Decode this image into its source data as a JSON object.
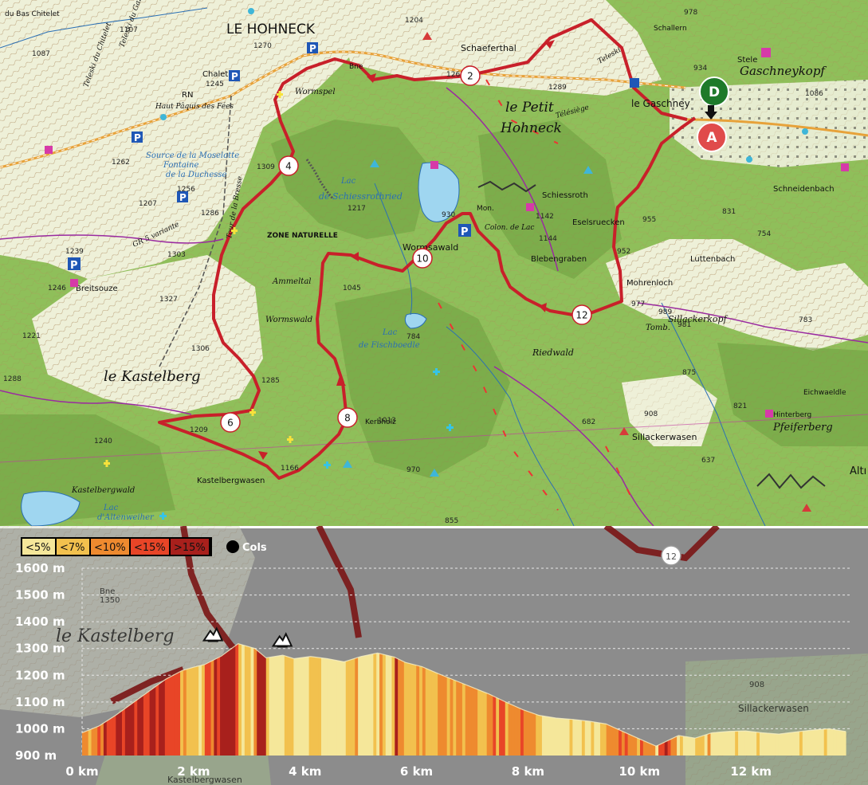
{
  "map": {
    "labels": [
      {
        "text": "LE HOHNECK",
        "cls": "ml",
        "size": 17
      },
      {
        "text": "Schaeferthal",
        "cls": "ml",
        "size": 11
      },
      {
        "text": "le Petit",
        "cls": "ml-it",
        "size": 17
      },
      {
        "text": "Hohneck",
        "cls": "ml-it",
        "size": 17
      },
      {
        "text": "le Gaschney",
        "cls": "ml",
        "size": 12
      },
      {
        "text": "Gaschneykopf",
        "cls": "ml-it",
        "size": 15
      },
      {
        "text": "Chalet",
        "cls": "ml",
        "size": 10
      },
      {
        "text": "Haut Pâquis des Fées",
        "cls": "ml-it",
        "size": 9
      },
      {
        "text": "Source de la Moselotte",
        "cls": "ml-blue",
        "size": 10
      },
      {
        "text": "Fontaine",
        "cls": "ml-blue",
        "size": 10
      },
      {
        "text": "de la Duchesse",
        "cls": "ml-blue",
        "size": 10
      },
      {
        "text": "Lac",
        "cls": "ml-blue",
        "size": 10
      },
      {
        "text": "de Schiessrothried",
        "cls": "ml-blue",
        "size": 11
      },
      {
        "text": "ZONE NATURELLE",
        "cls": "ml-bold",
        "size": 9
      },
      {
        "text": "Wormsawald",
        "cls": "ml",
        "size": 11
      },
      {
        "text": "Schiessroth",
        "cls": "ml",
        "size": 10
      },
      {
        "text": "Eselsruecken",
        "cls": "ml",
        "size": 10
      },
      {
        "text": "Blebengraben",
        "cls": "ml",
        "size": 10
      },
      {
        "text": "Mohrenloch",
        "cls": "ml",
        "size": 10
      },
      {
        "text": "Luttenbach",
        "cls": "ml",
        "size": 10
      },
      {
        "text": "Schneidenbach",
        "cls": "ml",
        "size": 10
      },
      {
        "text": "Sillackerkopf",
        "cls": "ml-it",
        "size": 11
      },
      {
        "text": "Riedwald",
        "cls": "ml-it",
        "size": 11
      },
      {
        "text": "Lac",
        "cls": "ml-blue",
        "size": 10
      },
      {
        "text": "de Fischboedle",
        "cls": "ml-blue",
        "size": 10
      },
      {
        "text": "Wormswald",
        "cls": "ml-it",
        "size": 10
      },
      {
        "text": "Ammeltal",
        "cls": "ml-it",
        "size": 10
      },
      {
        "text": "le Kastelberg",
        "cls": "ml-it",
        "size": 18
      },
      {
        "text": "Breitsouze",
        "cls": "ml",
        "size": 10
      },
      {
        "text": "Kastelbergwasen",
        "cls": "ml",
        "size": 10
      },
      {
        "text": "Kastelbergwald",
        "cls": "ml-it",
        "size": 10
      },
      {
        "text": "Lac",
        "cls": "ml-blue",
        "size": 10
      },
      {
        "text": "d'Altenweiher",
        "cls": "ml-blue",
        "size": 10
      },
      {
        "text": "Sillackerwasen",
        "cls": "ml",
        "size": 11
      },
      {
        "text": "Pfeiferberg",
        "cls": "ml-it",
        "size": 13
      },
      {
        "text": "Hinterberg",
        "cls": "ml",
        "size": 9
      },
      {
        "text": "Eichwaeldle",
        "cls": "ml",
        "size": 9
      },
      {
        "text": "Tomb.",
        "cls": "ml-it",
        "size": 10
      },
      {
        "text": "Stele",
        "cls": "ml",
        "size": 10
      },
      {
        "text": "Schallern",
        "cls": "ml",
        "size": 9
      },
      {
        "text": "du Bas Chitelet",
        "cls": "ml",
        "size": 9
      },
      {
        "text": "Teleski du Chitelet",
        "cls": "ml-it",
        "size": 9
      },
      {
        "text": "Teleski du Gazon",
        "cls": "ml-it",
        "size": 9
      },
      {
        "text": "Teleski",
        "cls": "ml-it",
        "size": 9
      },
      {
        "text": "Télésiège",
        "cls": "ml-it",
        "size": 9
      },
      {
        "text": "Wormspel",
        "cls": "ml-it",
        "size": 10
      },
      {
        "text": "Mon.",
        "cls": "ml",
        "size": 9
      },
      {
        "text": "Colon. de Lac",
        "cls": "ml-it",
        "size": 9
      },
      {
        "text": "Kerbholz",
        "cls": "ml",
        "size": 9
      },
      {
        "text": "GR 5 variante",
        "cls": "ml-it",
        "size": 9
      },
      {
        "text": "Tour de la Bresse",
        "cls": "ml-it",
        "size": 9
      },
      {
        "text": "Bne",
        "cls": "ml",
        "size": 9
      },
      {
        "text": "RN",
        "cls": "ml",
        "size": 10
      },
      {
        "text": "Altı",
        "cls": "ml",
        "size": 13
      }
    ],
    "elevations": [
      "1087",
      "1107",
      "1204",
      "978",
      "1289",
      "1263",
      "1309",
      "1256",
      "1207",
      "1262",
      "1286",
      "1217",
      "930",
      "1142",
      "1144",
      "955",
      "952",
      "977",
      "989",
      "981",
      "754",
      "783",
      "875",
      "908",
      "821",
      "637",
      "682",
      "784",
      "1045",
      "1327",
      "1303",
      "1239",
      "1246",
      "1221",
      "1306",
      "1285",
      "1209",
      "1240",
      "1166",
      "970",
      "855",
      "831",
      "1013",
      "1086",
      "934",
      "1245",
      "1270",
      "1288"
    ],
    "waypoints": [
      "2",
      "4",
      "6",
      "8",
      "10",
      "12"
    ],
    "start_label": "D",
    "end_label": "A"
  },
  "chart_data": {
    "type": "area",
    "title": "",
    "xlabel": "",
    "ylabel": "",
    "xlim": [
      0,
      13.8
    ],
    "ylim": [
      900,
      1600
    ],
    "x_ticks": [
      0,
      2,
      4,
      6,
      8,
      10,
      12
    ],
    "x_tick_labels": [
      "0 km",
      "2 km",
      "4 km",
      "6 km",
      "8 km",
      "10 km",
      "12 km"
    ],
    "y_ticks": [
      900,
      1000,
      1100,
      1200,
      1300,
      1400,
      1500,
      1600
    ],
    "y_tick_labels": [
      "900 m",
      "1000 m",
      "1100 m",
      "1200 m",
      "1300 m",
      "1400 m",
      "1500 m",
      "1600 m"
    ],
    "grid": true,
    "x": [
      0,
      0.3,
      0.6,
      0.9,
      1.2,
      1.5,
      1.8,
      2.0,
      2.2,
      2.5,
      2.8,
      3.1,
      3.3,
      3.6,
      3.8,
      4.1,
      4.4,
      4.7,
      5.0,
      5.3,
      5.6,
      5.8,
      6.1,
      6.4,
      6.7,
      7.0,
      7.3,
      7.6,
      7.9,
      8.2,
      8.5,
      8.8,
      9.1,
      9.4,
      9.7,
      10.0,
      10.3,
      10.5,
      10.7,
      11.0,
      11.3,
      11.6,
      11.9,
      12.2,
      12.5,
      12.8,
      13.1,
      13.4,
      13.7
    ],
    "elevation": [
      985,
      1010,
      1050,
      1095,
      1140,
      1185,
      1218,
      1230,
      1240,
      1272,
      1318,
      1300,
      1265,
      1275,
      1262,
      1270,
      1262,
      1250,
      1270,
      1283,
      1268,
      1248,
      1232,
      1205,
      1180,
      1155,
      1130,
      1100,
      1072,
      1050,
      1040,
      1035,
      1028,
      1018,
      990,
      962,
      935,
      955,
      975,
      965,
      985,
      990,
      992,
      985,
      980,
      988,
      995,
      1000,
      990
    ],
    "legend": {
      "placement": "top-left",
      "items": [
        {
          "label": "<5%",
          "color": "#f5e79a"
        },
        {
          "label": "<7%",
          "color": "#f2c14e"
        },
        {
          "label": "<10%",
          "color": "#ee8a2f"
        },
        {
          "label": "<15%",
          "color": "#e84527"
        },
        {
          "label": ">15%",
          "color": "#a8201c"
        }
      ],
      "cols_label": "Cols"
    },
    "passes": [
      3.2,
      3.8
    ],
    "slope_colors": [
      "#f5e79a",
      "#f2c14e",
      "#ee8a2f",
      "#e84527",
      "#a8201c"
    ]
  },
  "colors": {
    "route": "#c8202a",
    "forest": "#8fbf5a",
    "open": "#eef0d8",
    "chart_bg": "#8c8c8c"
  }
}
